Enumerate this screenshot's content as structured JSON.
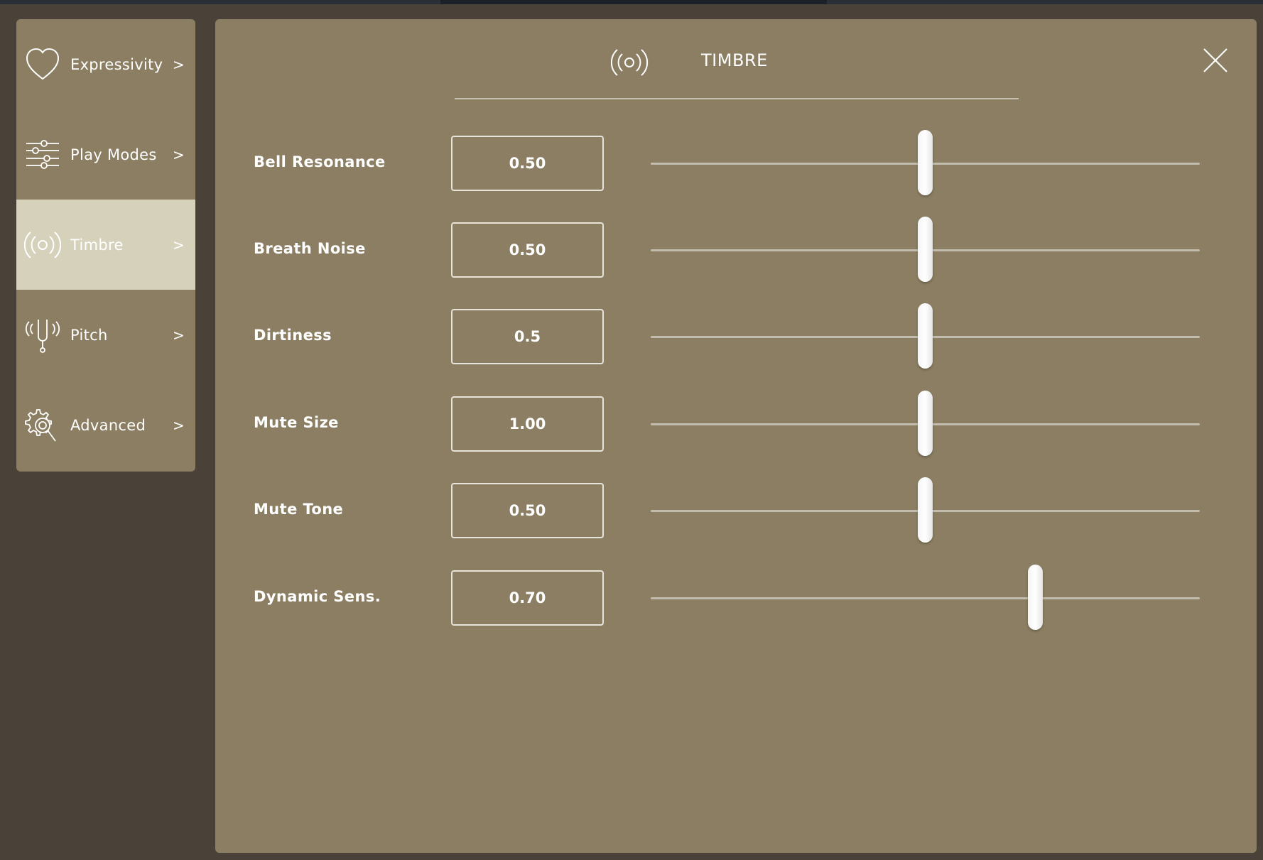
{
  "sidebar": {
    "items": [
      {
        "label": "Expressivity",
        "chevron": ">",
        "icon": "heart-icon",
        "active": false
      },
      {
        "label": "Play Modes",
        "chevron": ">",
        "icon": "sliders-icon",
        "active": false
      },
      {
        "label": "Timbre",
        "chevron": ">",
        "icon": "broadcast-icon",
        "active": true
      },
      {
        "label": "Pitch",
        "chevron": ">",
        "icon": "tuning-fork-icon",
        "active": false
      },
      {
        "label": "Advanced",
        "chevron": ">",
        "icon": "gear-search-icon",
        "active": false
      }
    ]
  },
  "panel": {
    "title": "TIMBRE",
    "title_icon": "broadcast-icon",
    "close_icon": "close-icon",
    "params": [
      {
        "label": "Bell Resonance",
        "value": "0.50",
        "fraction": 0.5
      },
      {
        "label": "Breath Noise",
        "value": "0.50",
        "fraction": 0.5
      },
      {
        "label": "Dirtiness",
        "value": "0.5",
        "fraction": 0.5
      },
      {
        "label": "Mute Size",
        "value": "1.00",
        "fraction": 0.5
      },
      {
        "label": "Mute Tone",
        "value": "0.50",
        "fraction": 0.5
      },
      {
        "label": "Dynamic Sens.",
        "value": "0.70",
        "fraction": 0.7
      }
    ]
  },
  "colors": {
    "background": "#4a4138",
    "panel": "#8b7e62",
    "active_item": "#d5d1bb",
    "text": "#ffffff"
  }
}
